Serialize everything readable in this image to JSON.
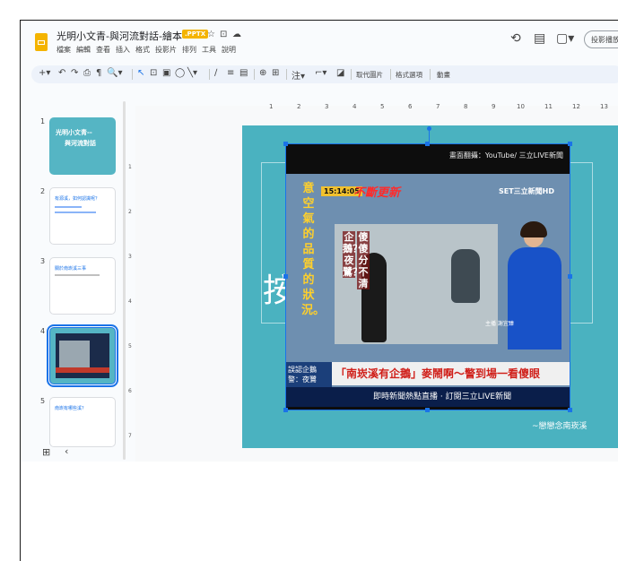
{
  "title_bar": {
    "doc_title": "光明小文青-與河流對話-繪本",
    "file_badge": ".PPTX",
    "star_icon": "☆",
    "folder_icon": "⊡",
    "cloud_icon": "☁",
    "menus": [
      "檔案",
      "編輯",
      "查看",
      "插入",
      "格式",
      "投影片",
      "排列",
      "工具",
      "說明"
    ],
    "history_icon": "⟲",
    "comments_icon": "▤",
    "camera_icon": "▢▾",
    "present_label": "投影播放"
  },
  "toolbar": {
    "new_slide": "+▾",
    "undo": "↶",
    "redo": "↷",
    "print": "⎙",
    "paint_format": "¶",
    "zoom": "🔍▾",
    "select": "↖",
    "text_box": "⊡",
    "image": "▣",
    "shape": "◯",
    "line": "╲▾",
    "pen": "∕",
    "align": "≡",
    "columns": "▤",
    "link": "⊕",
    "comment": "⊞",
    "alt": "注▾",
    "crop": "⌐▾",
    "mask": "◪",
    "replace_image": "取代圖片",
    "format_options": "格式選項",
    "animate": "動畫"
  },
  "filmstrip": {
    "slides": [
      {
        "num": "1",
        "title_lines": [
          "光明小文青--",
          "與河流對話"
        ]
      },
      {
        "num": "2",
        "title": "有源溪，如何認識呢？"
      },
      {
        "num": "3",
        "title": "關於南崁溪三事"
      },
      {
        "num": "4"
      },
      {
        "num": "5",
        "title": "南崁有哪些溪？"
      }
    ],
    "grid_icon": "⊞",
    "collapse_icon": "‹"
  },
  "ruler": {
    "h_ticks": [
      "1",
      "2",
      "3",
      "4",
      "5",
      "6",
      "7",
      "8",
      "9",
      "10",
      "11",
      "12",
      "13"
    ],
    "v_ticks": [
      "1",
      "2",
      "3",
      "4",
      "5",
      "6",
      "7"
    ]
  },
  "slide": {
    "placeholder_char": "按",
    "caption": "~戀戀念南崁溪",
    "image": {
      "credit": "畫面翻攝：YouTube/ 三立LIVE新聞",
      "time": "15:14:05",
      "breaking": "不斷更新",
      "channel_logo": "SET三立新聞HD",
      "vertical_text": "意空氣的品質的狀況。",
      "question_1": "企鵝？夜鷺？",
      "question_2": "傻傻分不清",
      "anchor_role": "主播 謝宜臻",
      "lower_left": "誤認企鵝 警：夜鷺",
      "headline": "「南崁溪有企鵝」麥鬧啊～警到場一看傻眼",
      "ticker": "即時新聞熱點直播 · 訂閱三立LIVE新聞"
    }
  }
}
